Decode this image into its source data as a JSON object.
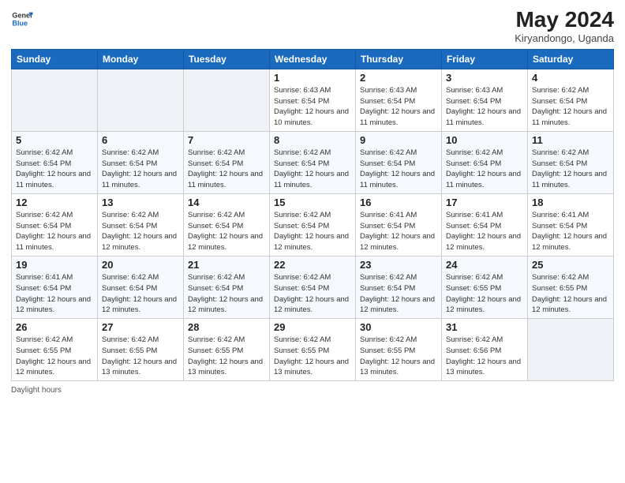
{
  "header": {
    "logo_general": "General",
    "logo_blue": "Blue",
    "month_title": "May 2024",
    "location": "Kiryandongo, Uganda"
  },
  "days_of_week": [
    "Sunday",
    "Monday",
    "Tuesday",
    "Wednesday",
    "Thursday",
    "Friday",
    "Saturday"
  ],
  "footer_label": "Daylight hours",
  "weeks": [
    [
      {
        "day": "",
        "info": ""
      },
      {
        "day": "",
        "info": ""
      },
      {
        "day": "",
        "info": ""
      },
      {
        "day": "1",
        "info": "Sunrise: 6:43 AM\nSunset: 6:54 PM\nDaylight: 12 hours\nand 10 minutes."
      },
      {
        "day": "2",
        "info": "Sunrise: 6:43 AM\nSunset: 6:54 PM\nDaylight: 12 hours\nand 11 minutes."
      },
      {
        "day": "3",
        "info": "Sunrise: 6:43 AM\nSunset: 6:54 PM\nDaylight: 12 hours\nand 11 minutes."
      },
      {
        "day": "4",
        "info": "Sunrise: 6:42 AM\nSunset: 6:54 PM\nDaylight: 12 hours\nand 11 minutes."
      }
    ],
    [
      {
        "day": "5",
        "info": "Sunrise: 6:42 AM\nSunset: 6:54 PM\nDaylight: 12 hours\nand 11 minutes."
      },
      {
        "day": "6",
        "info": "Sunrise: 6:42 AM\nSunset: 6:54 PM\nDaylight: 12 hours\nand 11 minutes."
      },
      {
        "day": "7",
        "info": "Sunrise: 6:42 AM\nSunset: 6:54 PM\nDaylight: 12 hours\nand 11 minutes."
      },
      {
        "day": "8",
        "info": "Sunrise: 6:42 AM\nSunset: 6:54 PM\nDaylight: 12 hours\nand 11 minutes."
      },
      {
        "day": "9",
        "info": "Sunrise: 6:42 AM\nSunset: 6:54 PM\nDaylight: 12 hours\nand 11 minutes."
      },
      {
        "day": "10",
        "info": "Sunrise: 6:42 AM\nSunset: 6:54 PM\nDaylight: 12 hours\nand 11 minutes."
      },
      {
        "day": "11",
        "info": "Sunrise: 6:42 AM\nSunset: 6:54 PM\nDaylight: 12 hours\nand 11 minutes."
      }
    ],
    [
      {
        "day": "12",
        "info": "Sunrise: 6:42 AM\nSunset: 6:54 PM\nDaylight: 12 hours\nand 11 minutes."
      },
      {
        "day": "13",
        "info": "Sunrise: 6:42 AM\nSunset: 6:54 PM\nDaylight: 12 hours\nand 12 minutes."
      },
      {
        "day": "14",
        "info": "Sunrise: 6:42 AM\nSunset: 6:54 PM\nDaylight: 12 hours\nand 12 minutes."
      },
      {
        "day": "15",
        "info": "Sunrise: 6:42 AM\nSunset: 6:54 PM\nDaylight: 12 hours\nand 12 minutes."
      },
      {
        "day": "16",
        "info": "Sunrise: 6:41 AM\nSunset: 6:54 PM\nDaylight: 12 hours\nand 12 minutes."
      },
      {
        "day": "17",
        "info": "Sunrise: 6:41 AM\nSunset: 6:54 PM\nDaylight: 12 hours\nand 12 minutes."
      },
      {
        "day": "18",
        "info": "Sunrise: 6:41 AM\nSunset: 6:54 PM\nDaylight: 12 hours\nand 12 minutes."
      }
    ],
    [
      {
        "day": "19",
        "info": "Sunrise: 6:41 AM\nSunset: 6:54 PM\nDaylight: 12 hours\nand 12 minutes."
      },
      {
        "day": "20",
        "info": "Sunrise: 6:42 AM\nSunset: 6:54 PM\nDaylight: 12 hours\nand 12 minutes."
      },
      {
        "day": "21",
        "info": "Sunrise: 6:42 AM\nSunset: 6:54 PM\nDaylight: 12 hours\nand 12 minutes."
      },
      {
        "day": "22",
        "info": "Sunrise: 6:42 AM\nSunset: 6:54 PM\nDaylight: 12 hours\nand 12 minutes."
      },
      {
        "day": "23",
        "info": "Sunrise: 6:42 AM\nSunset: 6:54 PM\nDaylight: 12 hours\nand 12 minutes."
      },
      {
        "day": "24",
        "info": "Sunrise: 6:42 AM\nSunset: 6:55 PM\nDaylight: 12 hours\nand 12 minutes."
      },
      {
        "day": "25",
        "info": "Sunrise: 6:42 AM\nSunset: 6:55 PM\nDaylight: 12 hours\nand 12 minutes."
      }
    ],
    [
      {
        "day": "26",
        "info": "Sunrise: 6:42 AM\nSunset: 6:55 PM\nDaylight: 12 hours\nand 12 minutes."
      },
      {
        "day": "27",
        "info": "Sunrise: 6:42 AM\nSunset: 6:55 PM\nDaylight: 12 hours\nand 13 minutes."
      },
      {
        "day": "28",
        "info": "Sunrise: 6:42 AM\nSunset: 6:55 PM\nDaylight: 12 hours\nand 13 minutes."
      },
      {
        "day": "29",
        "info": "Sunrise: 6:42 AM\nSunset: 6:55 PM\nDaylight: 12 hours\nand 13 minutes."
      },
      {
        "day": "30",
        "info": "Sunrise: 6:42 AM\nSunset: 6:55 PM\nDaylight: 12 hours\nand 13 minutes."
      },
      {
        "day": "31",
        "info": "Sunrise: 6:42 AM\nSunset: 6:56 PM\nDaylight: 12 hours\nand 13 minutes."
      },
      {
        "day": "",
        "info": ""
      }
    ]
  ]
}
